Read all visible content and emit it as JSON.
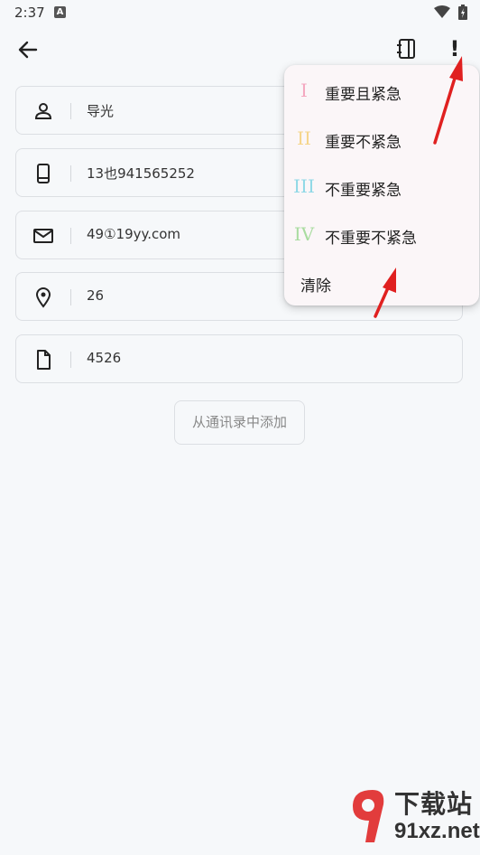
{
  "status_bar": {
    "time": "2:37",
    "notification_letter": "A"
  },
  "form": {
    "fields": [
      {
        "icon": "person-icon",
        "value": "导光"
      },
      {
        "icon": "phone-icon",
        "value": "13也941565252"
      },
      {
        "icon": "mail-icon",
        "value": "49①19yy.com"
      },
      {
        "icon": "location-icon",
        "value": "26"
      },
      {
        "icon": "document-icon",
        "value": "4526"
      }
    ],
    "add_from_contacts": "从通讯录中添加"
  },
  "priority_menu": {
    "items": [
      {
        "numeral": "I",
        "label": "重要且紧急",
        "color": "#f4a7bf"
      },
      {
        "numeral": "II",
        "label": "重要不紧急",
        "color": "#f5d58a"
      },
      {
        "numeral": "III",
        "label": "不重要紧急",
        "color": "#8fd8e6"
      },
      {
        "numeral": "IV",
        "label": "不重要不紧急",
        "color": "#a9dca0"
      }
    ],
    "clear": "清除"
  },
  "watermark": {
    "text": "下载站",
    "url": "91xz.net"
  }
}
